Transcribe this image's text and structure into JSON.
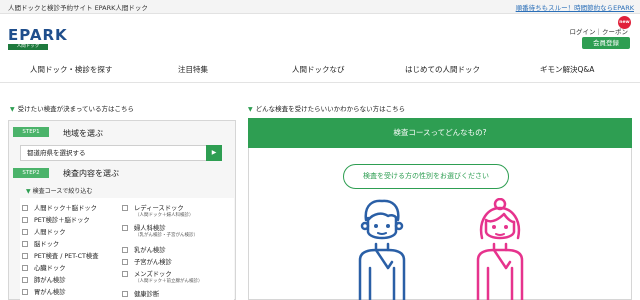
{
  "topbar": {
    "tagline": "人間ドックと検診予約サイト EPARK人間ドック",
    "promo": "順番待ちもスルー！時間節約ならEPARK"
  },
  "header": {
    "logo_text": "EPARK",
    "logo_sub": "人間ドック",
    "login": "ログイン｜クーポン",
    "new_badge": "new",
    "member_button": "会員登録"
  },
  "nav": {
    "items": [
      "人間ドック・検診を探す",
      "注目特集",
      "人間ドックなび",
      "はじめての人間ドック",
      "ギモン解決Q&A"
    ]
  },
  "left": {
    "heading": "受けたい検査が決まっている方はこちら",
    "step1_badge": "STEP1",
    "step1_label": "地域を選ぶ",
    "prefecture_placeholder": "都道府県を選択する",
    "step2_badge": "STEP2",
    "step2_label": "検査内容を選ぶ",
    "narrow_label": "検査コースで絞り込む",
    "col1": [
      "人間ドック＋脳ドック",
      "PET検診＋脳ドック",
      "人間ドック",
      "脳ドック",
      "PET検査 / PET-CT検査",
      "心臓ドック",
      "肺がん検診",
      "胃がん検診"
    ],
    "col2": [
      {
        "label": "レディースドック",
        "sub": "（人間ドック＋婦人科検診）"
      },
      {
        "label": "婦人科検診",
        "sub": "（乳がん検診・子宮がん検診）"
      },
      {
        "label": "乳がん検診",
        "sub": ""
      },
      {
        "label": "子宮がん検診",
        "sub": ""
      },
      {
        "label": "メンズドック",
        "sub": "（人間ドック＋前立腺がん検診）"
      },
      {
        "label": "健康診断",
        "sub": ""
      }
    ]
  },
  "right": {
    "heading": "どんな検査を受けたらいいかわからない方はこちら",
    "banner": "検査コースってどんなもの?",
    "gender_button": "検査を受ける方の性別をお選びください"
  },
  "colors": {
    "brand_green": "#2e9e52",
    "male_figure": "#2a5fa6",
    "female_figure": "#e6338d",
    "logo_blue": "#1f4e8c"
  }
}
